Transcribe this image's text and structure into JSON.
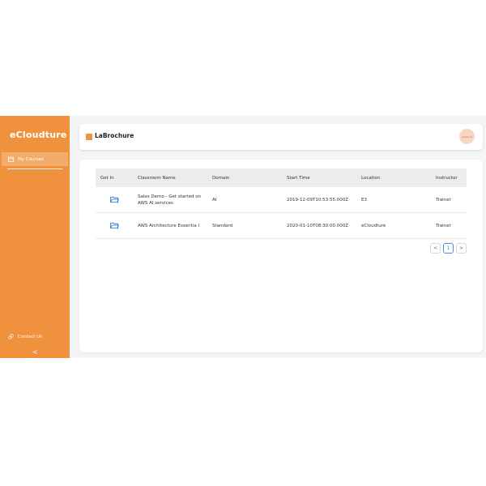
{
  "sidebar": {
    "brand": "eCloudture",
    "items": [
      {
        "label": "My Courses",
        "icon": "calendar-icon"
      }
    ],
    "contact_label": "Contact Us",
    "collapse_glyph": "<",
    "color": "#f0913d"
  },
  "header": {
    "title": "LaBrochure",
    "avatar_text": "ataaky.ai"
  },
  "table": {
    "headers": [
      "Get In",
      "Classroom Name",
      "Domain",
      "Start Time",
      "Location",
      "Instructor"
    ],
    "rows": [
      {
        "name": "Sales Demo - Get started on AWS AI services",
        "domain": "AI",
        "start": "2019-12-09T10:53:55.000Z",
        "location": "E3",
        "instructor": "Trainer"
      },
      {
        "name": "AWS Architecture Essentia l",
        "domain": "Standard",
        "start": "2020-01-10T08:30:00.000Z",
        "location": "eCloudture",
        "instructor": "Trainer"
      }
    ]
  },
  "pagination": {
    "prev": "<",
    "page": "1",
    "next": ">"
  }
}
